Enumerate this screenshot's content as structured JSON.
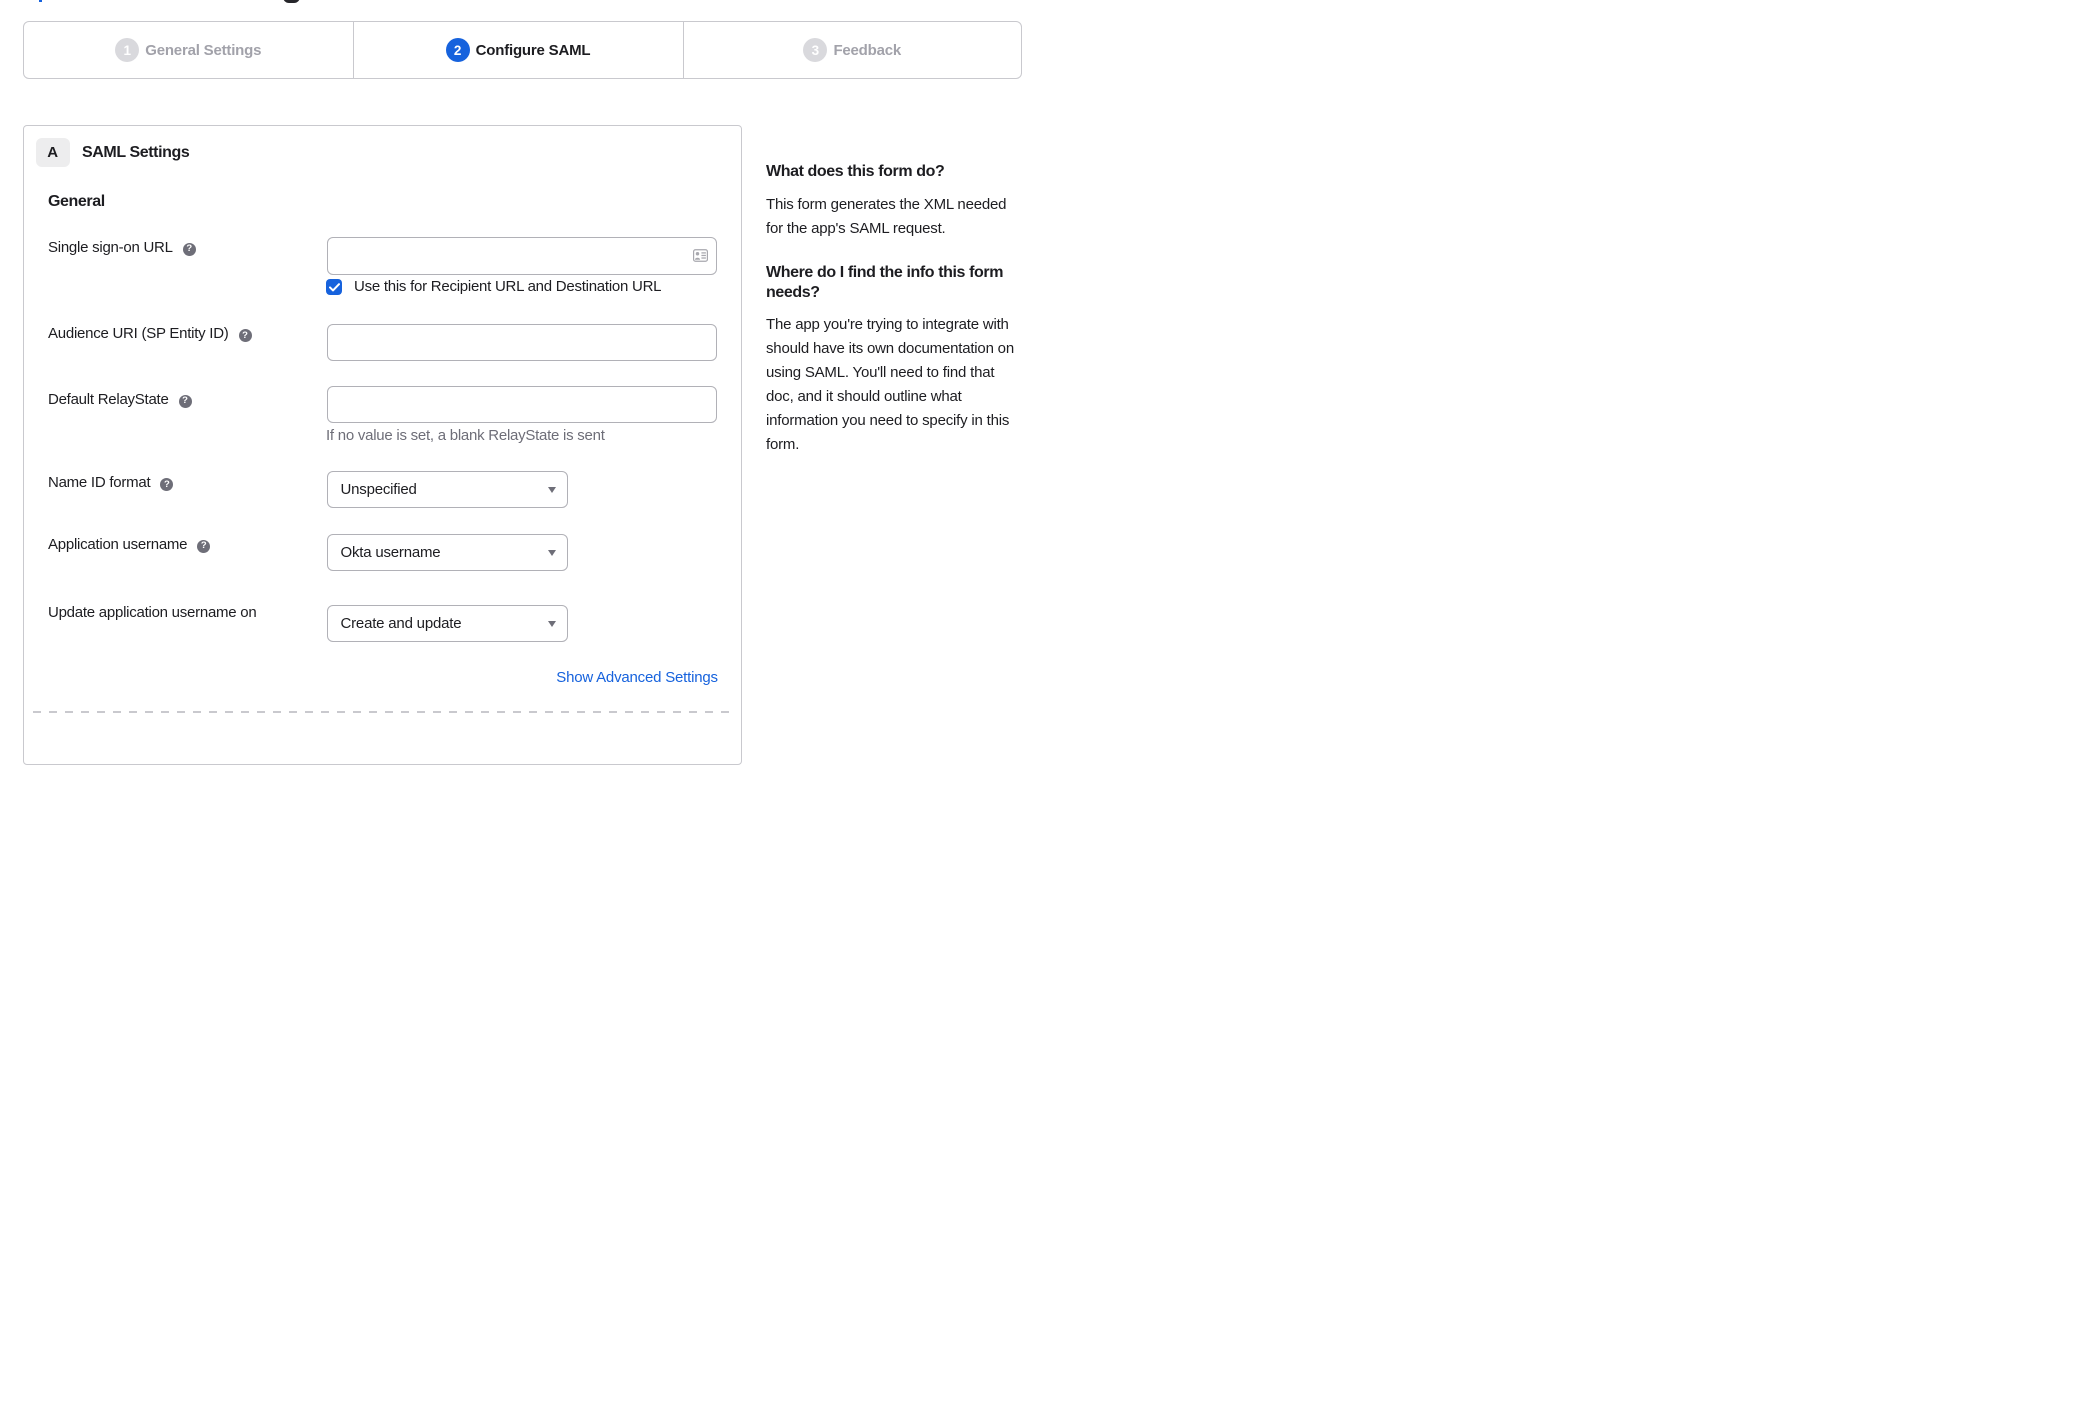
{
  "stepper": {
    "steps": [
      {
        "number": "1",
        "label": "General Settings",
        "state": "inactive"
      },
      {
        "number": "2",
        "label": "Configure SAML",
        "state": "active"
      },
      {
        "number": "3",
        "label": "Feedback",
        "state": "inactive"
      }
    ]
  },
  "panel": {
    "section_badge": "A",
    "section_title": "SAML Settings",
    "group_heading": "General",
    "fields": {
      "sso": {
        "label": "Single sign-on URL",
        "value": "",
        "has_help_icon": true,
        "checkbox_label": "Use this for Recipient URL and Destination URL",
        "checkbox_checked": true
      },
      "audience": {
        "label": "Audience URI (SP Entity ID)",
        "value": "",
        "has_help_icon": true
      },
      "relay": {
        "label": "Default RelayState",
        "value": "",
        "has_help_icon": true,
        "hint": "If no value is set, a blank RelayState is sent"
      },
      "nameid": {
        "label": "Name ID format",
        "value": "Unspecified",
        "has_help_icon": true
      },
      "appuser": {
        "label": "Application username",
        "value": "Okta username",
        "has_help_icon": true
      },
      "updateuser": {
        "label": "Update application username on",
        "value": "Create and update",
        "has_help_icon": false
      }
    },
    "help_icon_glyph": "?",
    "advanced_link": "Show Advanced Settings"
  },
  "sidebar": {
    "sections": [
      {
        "heading": "What does this form do?",
        "body": "This form generates the XML needed for the app's SAML request."
      },
      {
        "heading": "Where do I find the info this form needs?",
        "body": "The app you're trying to integrate with should have its own documentation on using SAML. You'll need to find that doc, and it should outline what information you need to specify in this form."
      }
    ]
  },
  "colors": {
    "accent_blue": "#1662dd",
    "text_dark": "#1d1d21",
    "text_gray": "#6e6e78",
    "inactive_gray": "#a2a2aa",
    "border_gray": "#c9c9ce"
  }
}
